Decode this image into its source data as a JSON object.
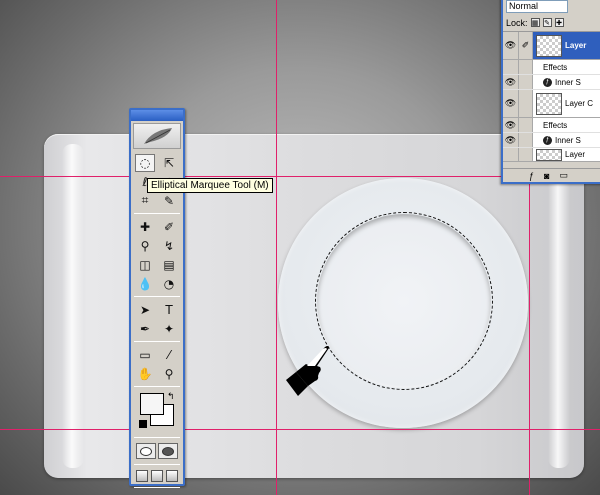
{
  "tooltip": {
    "text": "Elliptical Marquee Tool (M)"
  },
  "layers": {
    "blend_mode": "Normal",
    "lock_label": "Lock:",
    "items": [
      {
        "name": "Layer",
        "selected": true,
        "effects_label": "Effects",
        "effect": "Inner S"
      },
      {
        "name": "Layer C",
        "selected": false,
        "effects_label": "Effects",
        "effect": "Inner S"
      },
      {
        "name": "Layer",
        "selected": false
      }
    ]
  },
  "toolbox": {
    "icons": [
      "elliptical-marquee-icon",
      "move-icon",
      "lasso-icon",
      "magic-wand-icon",
      "crop-icon",
      "slice-icon",
      "healing-brush-icon",
      "brush-icon",
      "clone-stamp-icon",
      "history-brush-icon",
      "eraser-icon",
      "gradient-icon",
      "blur-icon",
      "dodge-icon",
      "path-selection-icon",
      "type-icon",
      "pen-icon",
      "shape-icon",
      "notes-icon",
      "eyedropper-icon",
      "hand-icon",
      "zoom-icon"
    ]
  },
  "colors": {
    "guide": "#e0206a",
    "panel_blue": "#3b6ec8"
  }
}
